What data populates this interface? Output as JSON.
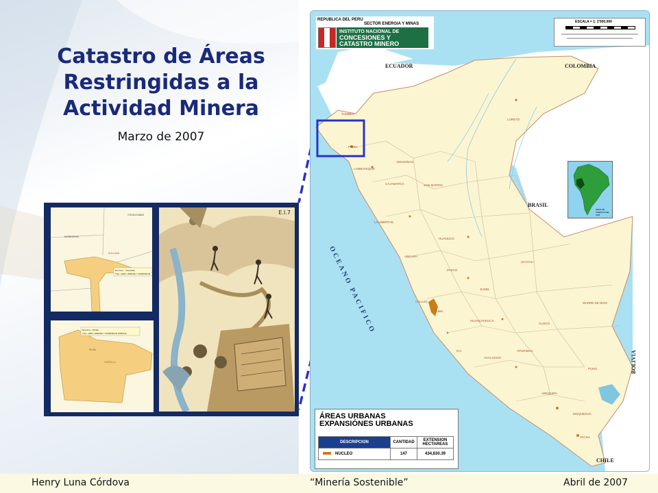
{
  "slide": {
    "title_lines": [
      "Catastro de Áreas",
      "Restringidas a la",
      "Actividad Minera"
    ],
    "date": "Marzo de 2007"
  },
  "thumbnails": {
    "thumb1": {
      "labels": [
        "CHULUCANAS",
        "MORROPON",
        "SULLANA"
      ],
      "note_lines": [
        "Nombre : SULLANA",
        "Tipo: AREA URBANA Y EXPANSION"
      ]
    },
    "thumb2": {
      "note_lines": [
        "Nombre : PIURA",
        "Tipo: AREA URBANA Y EXPANSION URBANA"
      ],
      "inner_labels": [
        "PIURA",
        "CASTILLA"
      ]
    },
    "drawing_tag": "E.I.7"
  },
  "map": {
    "header": {
      "republic": "REPUBLICA DEL PERU",
      "sector": "SECTOR ENERGIA Y MINAS",
      "institute_line1": "INSTITUTO NACIONAL DE",
      "institute_line2": "CONCESIONES Y",
      "institute_line3": "CATASTRO MINERO"
    },
    "scale_text": "ESCALA = 1: 2'500,000",
    "countries": {
      "ecuador": "ECUADOR",
      "colombia": "COLOMBIA",
      "brasil": "BRASIL",
      "bolivia": "BOLIVIA",
      "chile": "CHILE"
    },
    "ocean": "OCEANO PACIFICO",
    "regions": [
      "TUMBES",
      "PIURA",
      "LAMBAYEQUE",
      "CAJAMARCA",
      "AMAZONAS",
      "SAN MARTIN",
      "LORETO",
      "LA LIBERTAD",
      "ANCASH",
      "HUANUCO",
      "PASCO",
      "JUNIN",
      "LIMA",
      "CALLAO",
      "UCAYALI",
      "HUANCAVELICA",
      "ICA",
      "AYACUCHO",
      "APURIMAC",
      "CUSCO",
      "MADRE DE DIOS",
      "PUNO",
      "AREQUIPA",
      "MOQUEGUA",
      "TACNA"
    ],
    "inset_caption": "MAPA DE AMERICA DEL SUR",
    "legend": {
      "title_line1": "ÁREAS URBANAS",
      "title_line2": "EXPANSIÓNES URBANAS",
      "col_description": "DESCRIPCION",
      "col_quantity": "CANTIDAD",
      "col_extension": "EXTENSION HECTAREAS",
      "row_name": "NUCLEO",
      "row_quantity": "147",
      "row_extension": "434,830.39",
      "swatch_color": "#c97d1a"
    }
  },
  "footer": {
    "author": "Henry Luna Córdova",
    "event": "“Minería Sostenible”",
    "date": "Abril de 2007"
  },
  "colors": {
    "title": "#1a2a7a",
    "collage_frame": "#132a63",
    "highlight_box": "#2832c8",
    "ocean": "#a9e1f2",
    "land": "#fbf5d2",
    "urban_area": "#c97d1a"
  }
}
